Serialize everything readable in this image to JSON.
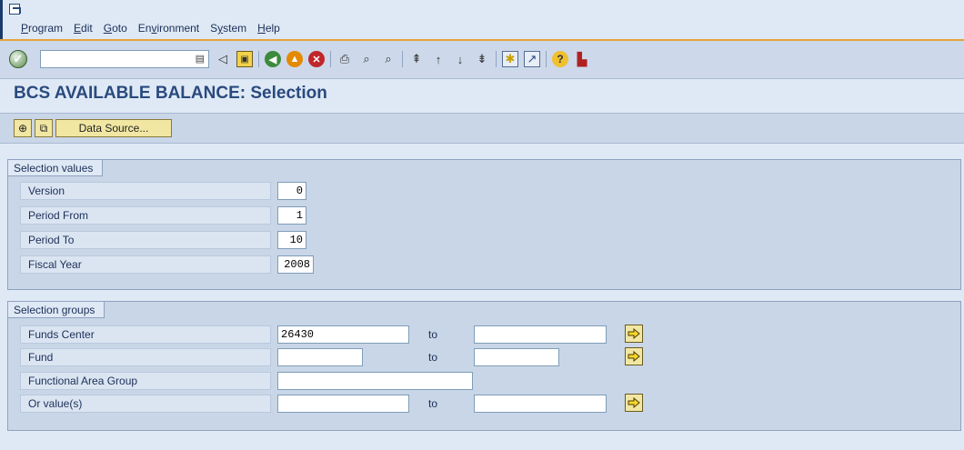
{
  "menu": {
    "items": [
      "Program",
      "Edit",
      "Goto",
      "Environment",
      "System",
      "Help"
    ],
    "underline": [
      "P",
      "E",
      "G",
      "v",
      "y",
      "H"
    ]
  },
  "toolbar": {
    "command_value": "",
    "icons": [
      "enter-icon",
      "back-arrow-icon",
      "save-icon",
      "back-icon",
      "exit-icon",
      "cancel-icon",
      "print-icon",
      "find-icon",
      "find-next-icon",
      "first-page-icon",
      "previous-page-icon",
      "next-page-icon",
      "last-page-icon",
      "new-session-icon",
      "shortcut-icon",
      "help-icon",
      "customize-layout-icon"
    ]
  },
  "page": {
    "title": "BCS AVAILABLE BALANCE: Selection"
  },
  "app_toolbar": {
    "execute_icon": "execute-icon",
    "variant_icon": "variant-icon",
    "data_source_label": "Data Source..."
  },
  "selection_values": {
    "title": "Selection values",
    "rows": [
      {
        "label": "Version",
        "value": "0"
      },
      {
        "label": "Period From",
        "value": "1"
      },
      {
        "label": "Period To",
        "value": "10"
      },
      {
        "label": "Fiscal Year",
        "value": "2008"
      }
    ]
  },
  "selection_groups": {
    "title": "Selection groups",
    "to_label": "to",
    "rows": [
      {
        "label": "Funds Center",
        "from": "26430",
        "to": ""
      },
      {
        "label": "Fund",
        "from": "",
        "to": ""
      },
      {
        "label": "Functional Area Group",
        "from": ""
      },
      {
        "label": "Or value(s)",
        "from": "",
        "to": ""
      }
    ]
  },
  "colors": {
    "title": "#2a4a7e",
    "menu_accent": "#e5a23a",
    "button_yellow": "#f1e7a3"
  }
}
